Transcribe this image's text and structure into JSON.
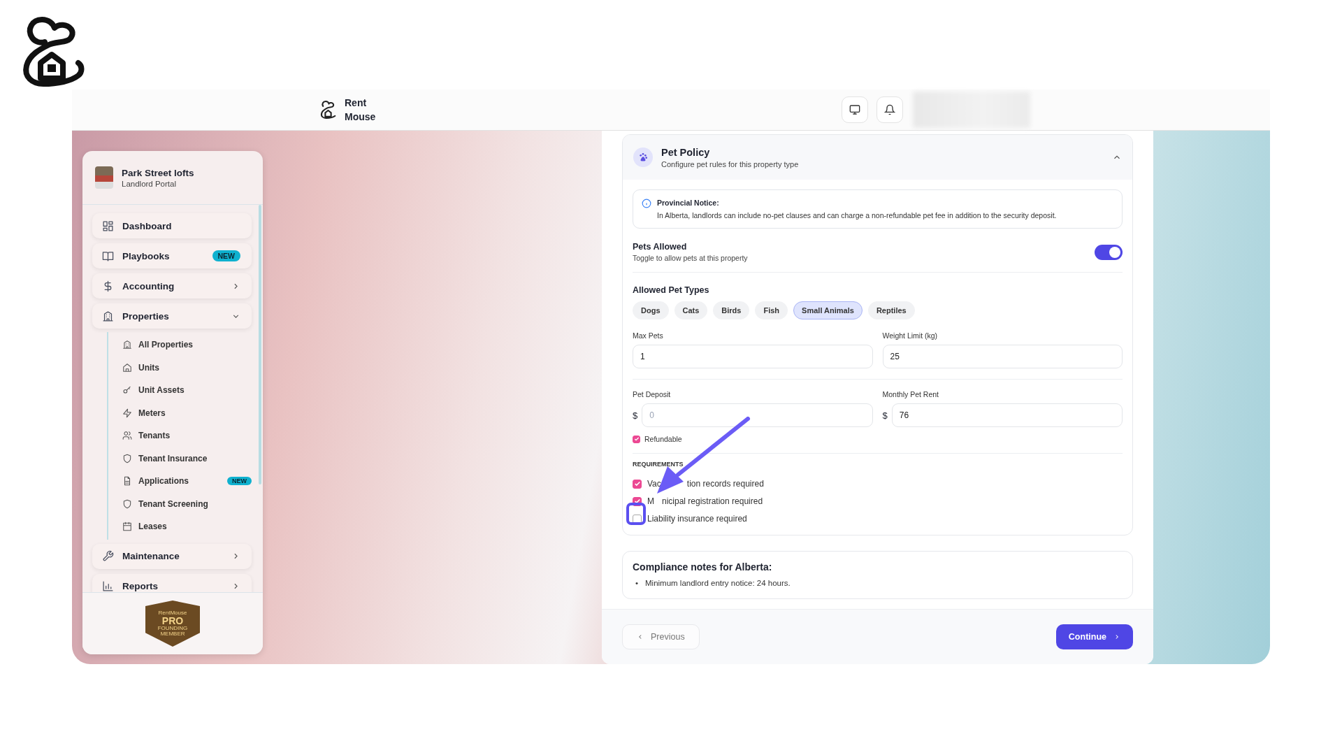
{
  "header": {
    "brand": "Rent Mouse"
  },
  "sidebar": {
    "org_name": "Park Street lofts",
    "org_subtitle": "Landlord Portal",
    "items": [
      {
        "kind": "link",
        "label": "Dashboard"
      },
      {
        "kind": "link",
        "label": "Playbooks",
        "badge": "NEW"
      },
      {
        "kind": "group",
        "label": "Accounting",
        "expanded": false
      },
      {
        "kind": "group",
        "label": "Properties",
        "expanded": true,
        "children": [
          {
            "label": "All Properties"
          },
          {
            "label": "Units"
          },
          {
            "label": "Unit Assets"
          },
          {
            "label": "Meters"
          },
          {
            "label": "Tenants"
          },
          {
            "label": "Tenant Insurance"
          },
          {
            "label": "Applications",
            "badge": "NEW"
          },
          {
            "label": "Tenant Screening"
          },
          {
            "label": "Leases"
          }
        ]
      },
      {
        "kind": "group",
        "label": "Maintenance",
        "expanded": false
      },
      {
        "kind": "group",
        "label": "Reports",
        "expanded": false
      }
    ],
    "badge_lines": [
      "RentMouse",
      "PRO",
      "FOUNDING",
      "MEMBER"
    ]
  },
  "pet_policy": {
    "title": "Pet Policy",
    "subtitle": "Configure pet rules for this property type",
    "expanded": true,
    "notice": {
      "title": "Provincial Notice:",
      "text": "In Alberta, landlords can include no-pet clauses and can charge a non-refundable pet fee in addition to the security deposit."
    },
    "pets_allowed": {
      "label": "Pets Allowed",
      "hint": "Toggle to allow pets at this property",
      "on": true
    },
    "pet_types_label": "Allowed Pet Types",
    "pet_types": [
      {
        "label": "Dogs",
        "selected": false
      },
      {
        "label": "Cats",
        "selected": false
      },
      {
        "label": "Birds",
        "selected": false
      },
      {
        "label": "Fish",
        "selected": false
      },
      {
        "label": "Small Animals",
        "selected": true
      },
      {
        "label": "Reptiles",
        "selected": false
      }
    ],
    "fields": [
      {
        "label": "Max Pets",
        "value": "1"
      },
      {
        "label": "Weight Limit (kg)",
        "value": "25"
      },
      {
        "label": "Pet Deposit",
        "prefix": "$",
        "placeholder": "0"
      },
      {
        "label": "Monthly Pet Rent",
        "prefix": "$",
        "value": "76"
      }
    ],
    "refundable": {
      "label": "Refundable",
      "checked": true
    },
    "requirements_label": "REQUIREMENTS",
    "requirements": [
      {
        "label_parts": [
          "Vac",
          "tion records required"
        ],
        "checked": true
      },
      {
        "label_parts": [
          "M",
          "nicipal registration required"
        ],
        "checked": true
      },
      {
        "label_parts": [
          "Liability insurance required"
        ],
        "checked": false
      }
    ]
  },
  "compliance": {
    "title": "Compliance notes for Alberta:",
    "notes": [
      {
        "bullet": "•",
        "text": "Minimum landlord entry notice: 24 hours."
      }
    ]
  },
  "footer": {
    "previous": "Previous",
    "continue": "Continue"
  }
}
